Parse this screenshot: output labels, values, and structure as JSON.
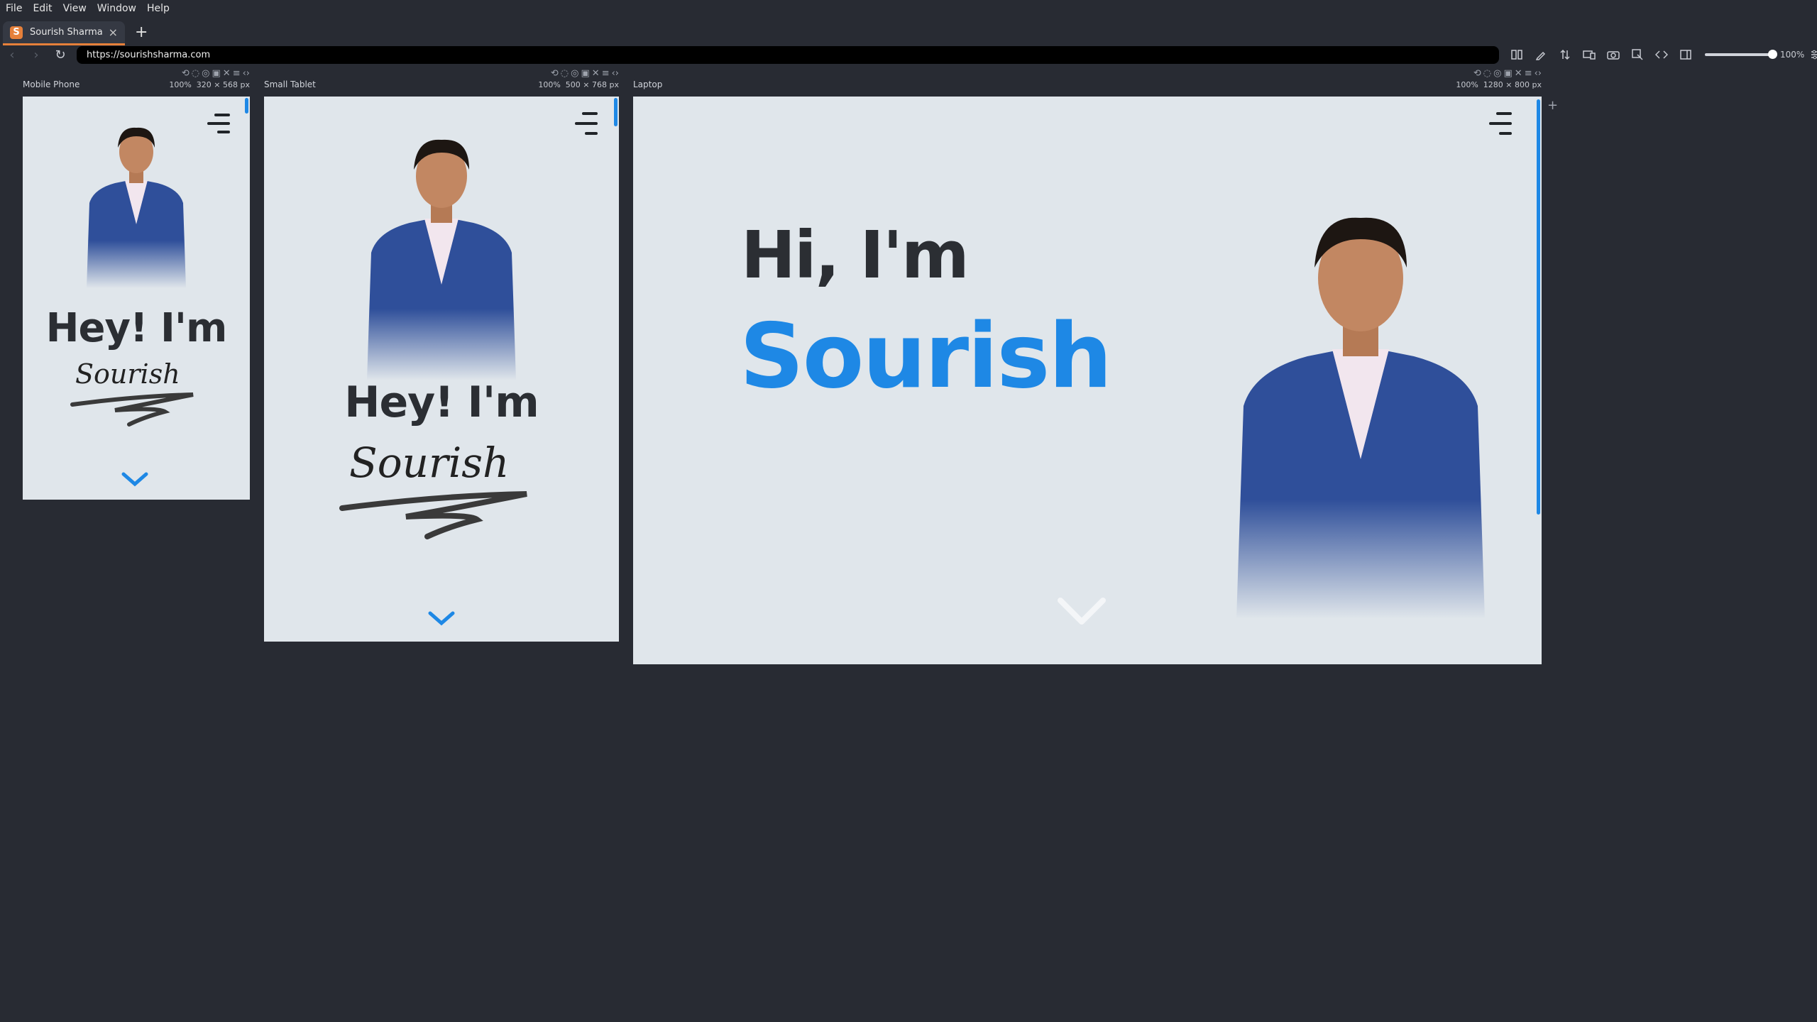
{
  "menu": [
    "File",
    "Edit",
    "View",
    "Window",
    "Help"
  ],
  "tab": {
    "title": "Sourish Sharma",
    "favicon": "S",
    "close": "×",
    "new": "+"
  },
  "nav": {
    "back": "‹",
    "forward": "›",
    "reload": "↻",
    "url": "https://sourishsharma.com"
  },
  "toolbar": {
    "zoom": "100%"
  },
  "devices": {
    "mobile": {
      "label": "Mobile Phone",
      "zoom": "100%",
      "dims": "320 × 568 px"
    },
    "tablet": {
      "label": "Small Tablet",
      "zoom": "100%",
      "dims": "500 × 768 px"
    },
    "laptop": {
      "label": "Laptop",
      "zoom": "100%",
      "dims": "1280 × 800 px"
    }
  },
  "site": {
    "hey": "Hey! I'm",
    "hi": "Hi, I'm",
    "name": "Sourish",
    "signature": "Sourish"
  },
  "colors": {
    "accent": "#1e88e5",
    "tab_accent": "#e6803a",
    "page_bg": "#e0e6eb",
    "app_bg": "#282b33"
  }
}
